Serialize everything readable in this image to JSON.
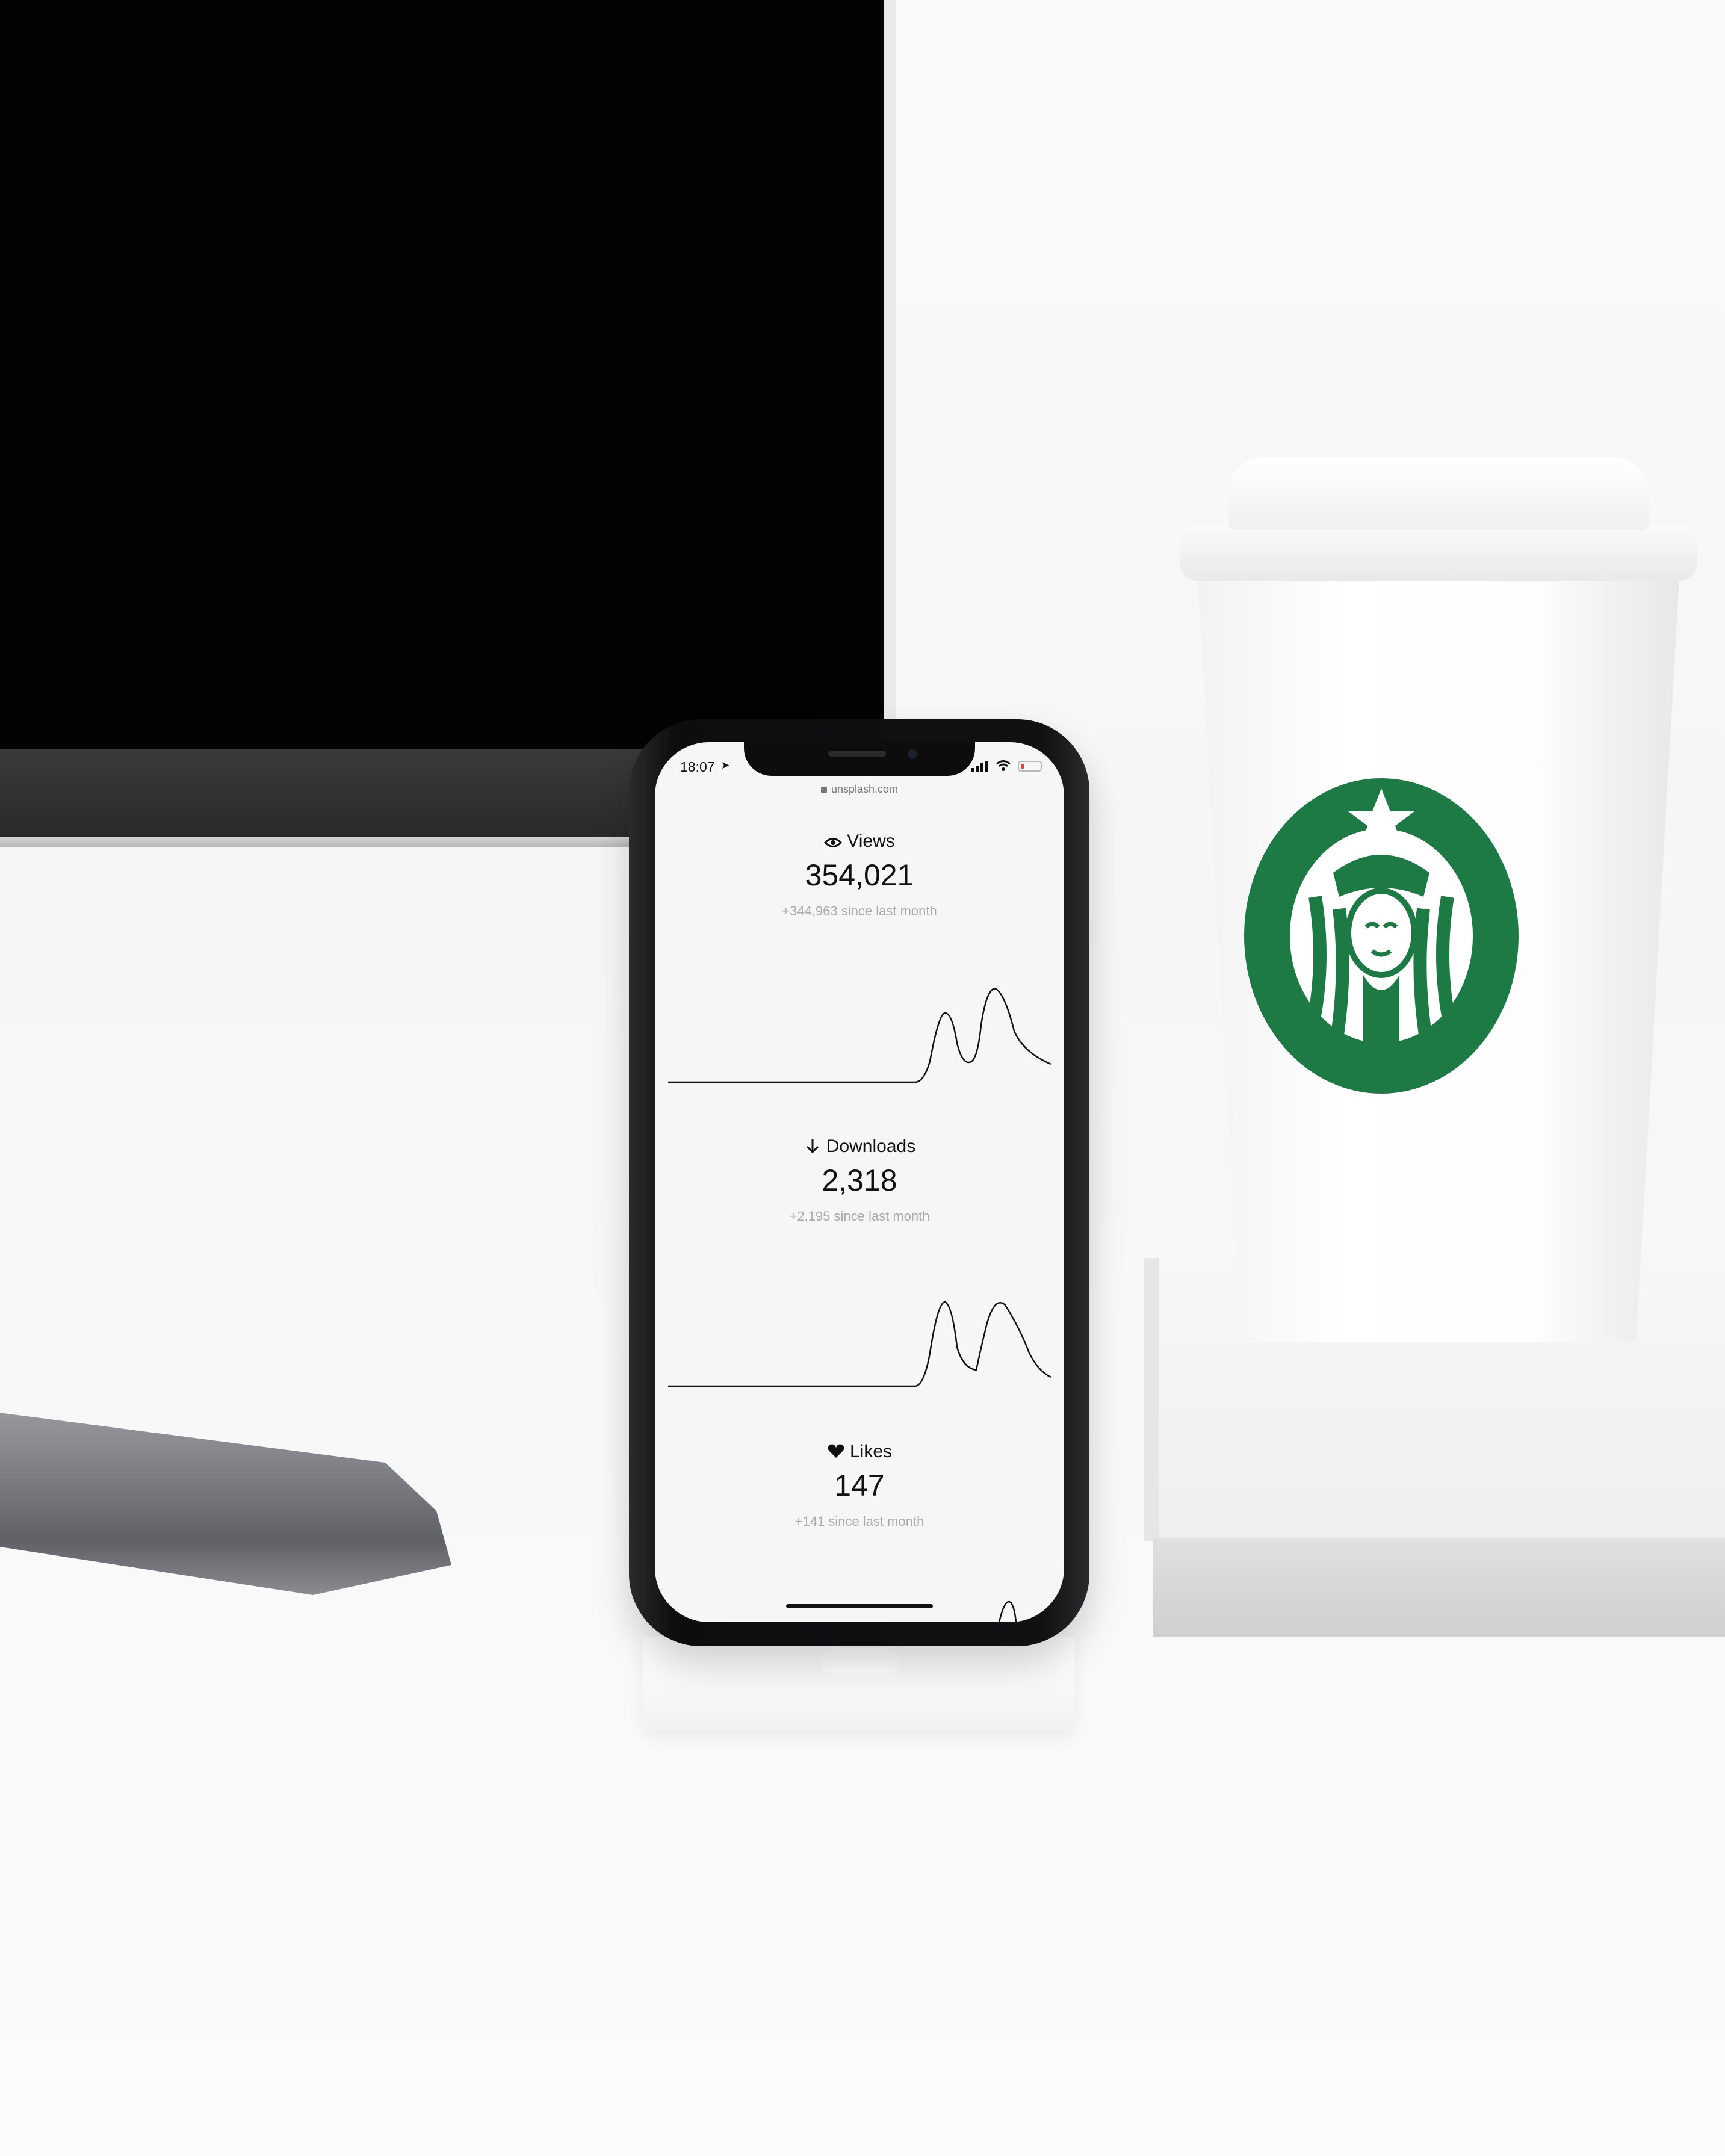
{
  "phone": {
    "status_time": "18:07",
    "url": "unsplash.com"
  },
  "stats": [
    {
      "label": "Views",
      "value": "354,021",
      "change": "+344,963 since last month",
      "icon": "eye-icon"
    },
    {
      "label": "Downloads",
      "value": "2,318",
      "change": "+2,195 since last month",
      "icon": "arrow-down-icon"
    },
    {
      "label": "Likes",
      "value": "147",
      "change": "+141 since last month",
      "icon": "heart-icon"
    }
  ],
  "colors": {
    "starbucks_green": "#1e7a45",
    "monitor_screen": "#030304",
    "phone_body": "#111112",
    "battery_low": "#e04040"
  }
}
